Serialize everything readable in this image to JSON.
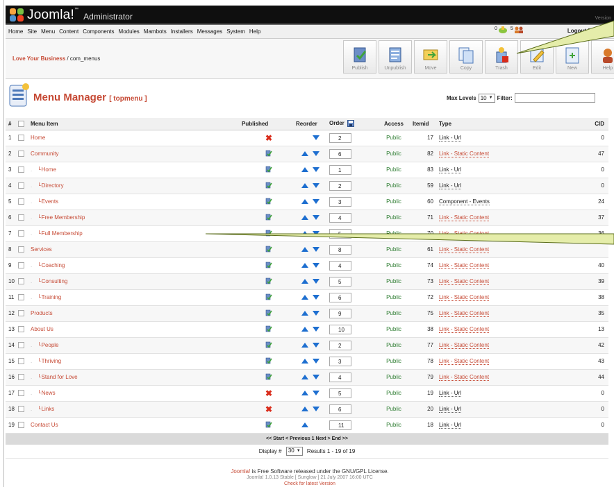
{
  "header": {
    "brand": "Joomla!",
    "trademark": "™",
    "subtitle": "Administrator",
    "version": "Version"
  },
  "menubar": {
    "items": [
      "Home",
      "Site",
      "Menu",
      "Content",
      "Components",
      "Modules",
      "Mambots",
      "Installers",
      "Messages",
      "System",
      "Help"
    ],
    "messages_count": "0",
    "users_count": "5",
    "logout": "Logout Peter Coo"
  },
  "breadcrumb": {
    "site": "Love Your Business",
    "path": " / com_menus"
  },
  "toolbar": {
    "buttons": [
      "Publish",
      "Unpublish",
      "Move",
      "Copy",
      "Trash",
      "Edit",
      "New",
      "Help"
    ]
  },
  "page": {
    "title": "Menu Manager",
    "menu": "[ topmenu ]",
    "max_levels_label": "Max Levels",
    "max_levels": "10",
    "filter_label": "Filter:",
    "filter_value": ""
  },
  "table": {
    "headers": {
      "num": "#",
      "item": "Menu Item",
      "published": "Published",
      "reorder": "Reorder",
      "order": "Order",
      "access": "Access",
      "itemid": "Itemid",
      "type": "Type",
      "cid": "CID"
    },
    "rows": [
      {
        "n": "1",
        "name": "Home",
        "child": false,
        "pub": false,
        "up": false,
        "down": true,
        "order": "2",
        "access": "Public",
        "itemid": "17",
        "type": "Link - Url",
        "tlink": false,
        "cid": "0"
      },
      {
        "n": "2",
        "name": "Community",
        "child": false,
        "pub": true,
        "up": true,
        "down": true,
        "order": "6",
        "access": "Public",
        "itemid": "82",
        "type": "Link - Static Content",
        "tlink": true,
        "cid": "47"
      },
      {
        "n": "3",
        "name": "Home",
        "child": true,
        "pub": true,
        "up": true,
        "down": true,
        "order": "1",
        "access": "Public",
        "itemid": "83",
        "type": "Link - Url",
        "tlink": false,
        "cid": "0"
      },
      {
        "n": "4",
        "name": "Directory",
        "child": true,
        "pub": true,
        "up": true,
        "down": true,
        "order": "2",
        "access": "Public",
        "itemid": "59",
        "type": "Link - Url",
        "tlink": false,
        "cid": "0"
      },
      {
        "n": "5",
        "name": "Events",
        "child": true,
        "pub": true,
        "up": true,
        "down": true,
        "order": "3",
        "access": "Public",
        "itemid": "60",
        "type": "Component - Events",
        "tlink": false,
        "cid": "24"
      },
      {
        "n": "6",
        "name": "Free Membership",
        "child": true,
        "pub": true,
        "up": true,
        "down": true,
        "order": "4",
        "access": "Public",
        "itemid": "71",
        "type": "Link - Static Content",
        "tlink": true,
        "cid": "37"
      },
      {
        "n": "7",
        "name": "Full Membership",
        "child": true,
        "pub": true,
        "up": true,
        "down": true,
        "order": "5",
        "access": "Public",
        "itemid": "70",
        "type": "Link - Static Content",
        "tlink": true,
        "cid": "36"
      },
      {
        "n": "8",
        "name": "Services",
        "child": false,
        "pub": true,
        "up": true,
        "down": true,
        "order": "8",
        "access": "Public",
        "itemid": "61",
        "type": "Link - Static Content",
        "tlink": true,
        "cid": ""
      },
      {
        "n": "9",
        "name": "Coaching",
        "child": true,
        "pub": true,
        "up": true,
        "down": true,
        "order": "4",
        "access": "Public",
        "itemid": "74",
        "type": "Link - Static Content",
        "tlink": true,
        "cid": "40"
      },
      {
        "n": "10",
        "name": "Consulting",
        "child": true,
        "pub": true,
        "up": true,
        "down": true,
        "order": "5",
        "access": "Public",
        "itemid": "73",
        "type": "Link - Static Content",
        "tlink": true,
        "cid": "39"
      },
      {
        "n": "11",
        "name": "Training",
        "child": true,
        "pub": true,
        "up": true,
        "down": true,
        "order": "6",
        "access": "Public",
        "itemid": "72",
        "type": "Link - Static Content",
        "tlink": true,
        "cid": "38"
      },
      {
        "n": "12",
        "name": "Products",
        "child": false,
        "pub": true,
        "up": true,
        "down": true,
        "order": "9",
        "access": "Public",
        "itemid": "75",
        "type": "Link - Static Content",
        "tlink": true,
        "cid": "35"
      },
      {
        "n": "13",
        "name": "About Us",
        "child": false,
        "pub": true,
        "up": true,
        "down": true,
        "order": "10",
        "access": "Public",
        "itemid": "38",
        "type": "Link - Static Content",
        "tlink": true,
        "cid": "13"
      },
      {
        "n": "14",
        "name": "People",
        "child": true,
        "pub": true,
        "up": true,
        "down": true,
        "order": "2",
        "access": "Public",
        "itemid": "77",
        "type": "Link - Static Content",
        "tlink": true,
        "cid": "42"
      },
      {
        "n": "15",
        "name": "Thriving",
        "child": true,
        "pub": true,
        "up": true,
        "down": true,
        "order": "3",
        "access": "Public",
        "itemid": "78",
        "type": "Link - Static Content",
        "tlink": true,
        "cid": "43"
      },
      {
        "n": "16",
        "name": "Stand for Love",
        "child": true,
        "pub": true,
        "up": true,
        "down": true,
        "order": "4",
        "access": "Public",
        "itemid": "79",
        "type": "Link - Static Content",
        "tlink": true,
        "cid": "44"
      },
      {
        "n": "17",
        "name": "News",
        "child": true,
        "pub": false,
        "up": true,
        "down": true,
        "order": "5",
        "access": "Public",
        "itemid": "19",
        "type": "Link - Url",
        "tlink": false,
        "cid": "0"
      },
      {
        "n": "18",
        "name": "Links",
        "child": true,
        "pub": false,
        "up": true,
        "down": true,
        "order": "6",
        "access": "Public",
        "itemid": "20",
        "type": "Link - Url",
        "tlink": false,
        "cid": "0"
      },
      {
        "n": "19",
        "name": "Contact Us",
        "child": false,
        "pub": true,
        "up": true,
        "down": false,
        "order": "11",
        "access": "Public",
        "itemid": "18",
        "type": "Link - Url",
        "tlink": false,
        "cid": "0"
      }
    ]
  },
  "pagination": {
    "nav": "<< Start < Previous 1 Next > End >>",
    "display_label": "Display #",
    "display_value": "30",
    "results": "Results 1 - 19 of 19"
  },
  "footer": {
    "link": "Joomla!",
    "license": " is Free Software released under the GNU/GPL License.",
    "version": "Joomla! 1.0.13 Stable [ Sunglow ] 21 July 2007 16:00 UTC",
    "check": "Check for latest Version"
  },
  "colors": {
    "accent": "#c64934",
    "public": "#2e7d32",
    "arrow": "#1e6fd0",
    "unpublished": "#d92b1a"
  }
}
